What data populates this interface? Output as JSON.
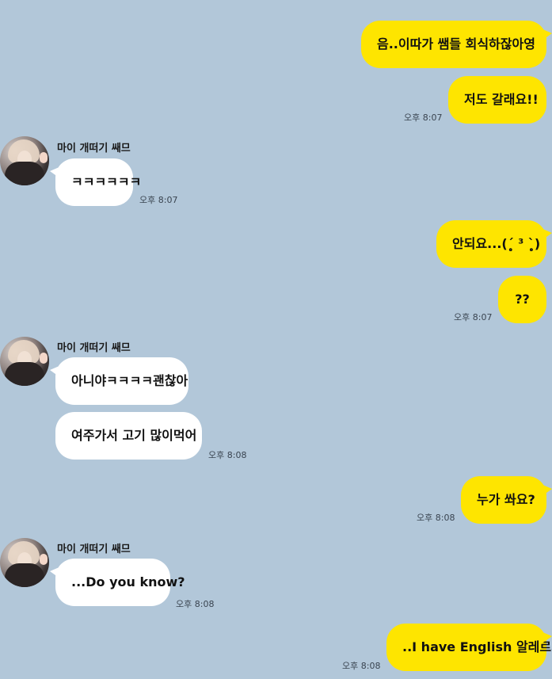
{
  "chat": {
    "partner_name": "마이 개떠기 쌔므",
    "messages": {
      "m1": "음..이따가 쌤들 회식하잖아영",
      "m2": "저도 갈래요!!",
      "m2_time": "오후 8:07",
      "m3": "ㅋㅋㅋㅋㅋㅋ",
      "m3_time": "오후 8:07",
      "m4": "안되요...(ˊ̥̥̥̥̥ ³ ˋ̥̥̥̥̥)",
      "m5": "??",
      "m5_time": "오후 8:07",
      "m6": "아니야ㅋㅋㅋㅋ괜찮아",
      "m7": "여주가서 고기 많이먹어",
      "m7_time": "오후 8:08",
      "m8": "누가 쏴요?",
      "m8_time": "오후 8:08",
      "m9": "...Do you know?",
      "m9_time": "오후 8:08",
      "m10": "..I have English 알레르기",
      "m10_time": "오후 8:08"
    }
  },
  "colors": {
    "background": "#b2c7d9",
    "my_bubble": "#fee500",
    "their_bubble": "#ffffff"
  }
}
